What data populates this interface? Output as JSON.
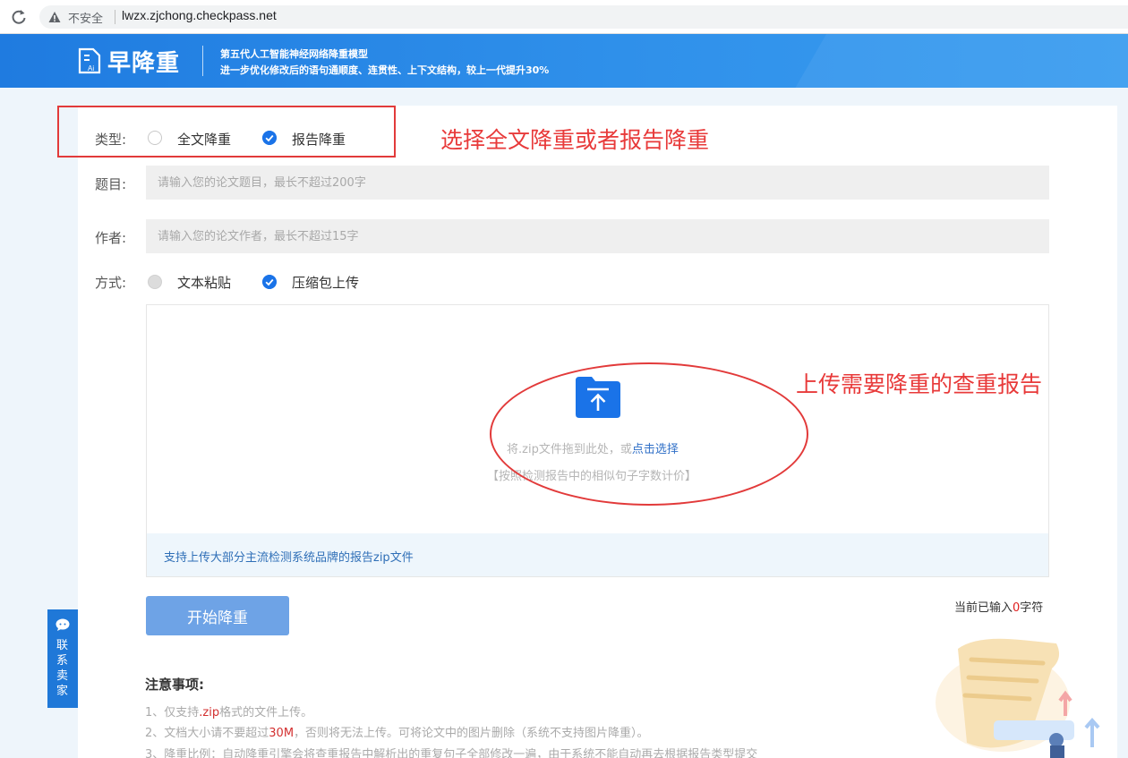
{
  "browser": {
    "security_label": "不安全",
    "url": "lwzx.zjchong.checkpass.net"
  },
  "header": {
    "logo_text": "早降重",
    "slogan_line1": "第五代人工智能神经网络降重模型",
    "slogan_line2": "进一步优化修改后的语句通顺度、连贯性、上下文结构，较上一代提升30%"
  },
  "form": {
    "type_label": "类型:",
    "type_options": [
      "全文降重",
      "报告降重"
    ],
    "type_selected": "报告降重",
    "title_label": "题目:",
    "title_placeholder": "请输入您的论文题目，最长不超过200字",
    "author_label": "作者:",
    "author_placeholder": "请输入您的论文作者，最长不超过15字",
    "method_label": "方式:",
    "method_options": [
      "文本粘贴",
      "压缩包上传"
    ],
    "method_selected": "压缩包上传"
  },
  "upload": {
    "drag_text": "将.zip文件拖到此处，或",
    "choose_link": "点击选择",
    "pricing_note": "【按照检测报告中的相似句子字数计价】",
    "support_note": "支持上传大部分主流检测系统品牌的报告zip文件"
  },
  "annotations": {
    "type_hint": "选择全文降重或者报告降重",
    "upload_hint": "上传需要降重的查重报告"
  },
  "actions": {
    "start_label": "开始降重",
    "count_prefix": "当前已输入",
    "count_value": "0",
    "count_suffix": "字符"
  },
  "notes": {
    "title": "注意事项:",
    "item1_a": "1、仅支持",
    "item1_red": ".zip",
    "item1_b": "格式的文件上传。",
    "item2_a": "2、文档大小请不要超过",
    "item2_red": "30M",
    "item2_b": "，否则将无法上传。可将论文中的图片删除（系统不支持图片降重）。",
    "item3": "3、降重比例：自动降重引擎会将查重报告中解析出的重复句子全部修改一遍，由于系统不能自动再去根据报告类型提交"
  },
  "contact": {
    "label": "联系卖家"
  },
  "colors": {
    "brand_blue": "#1f7be0",
    "annotation_red": "#e23a3a",
    "button_blue": "#6ea3e6"
  }
}
